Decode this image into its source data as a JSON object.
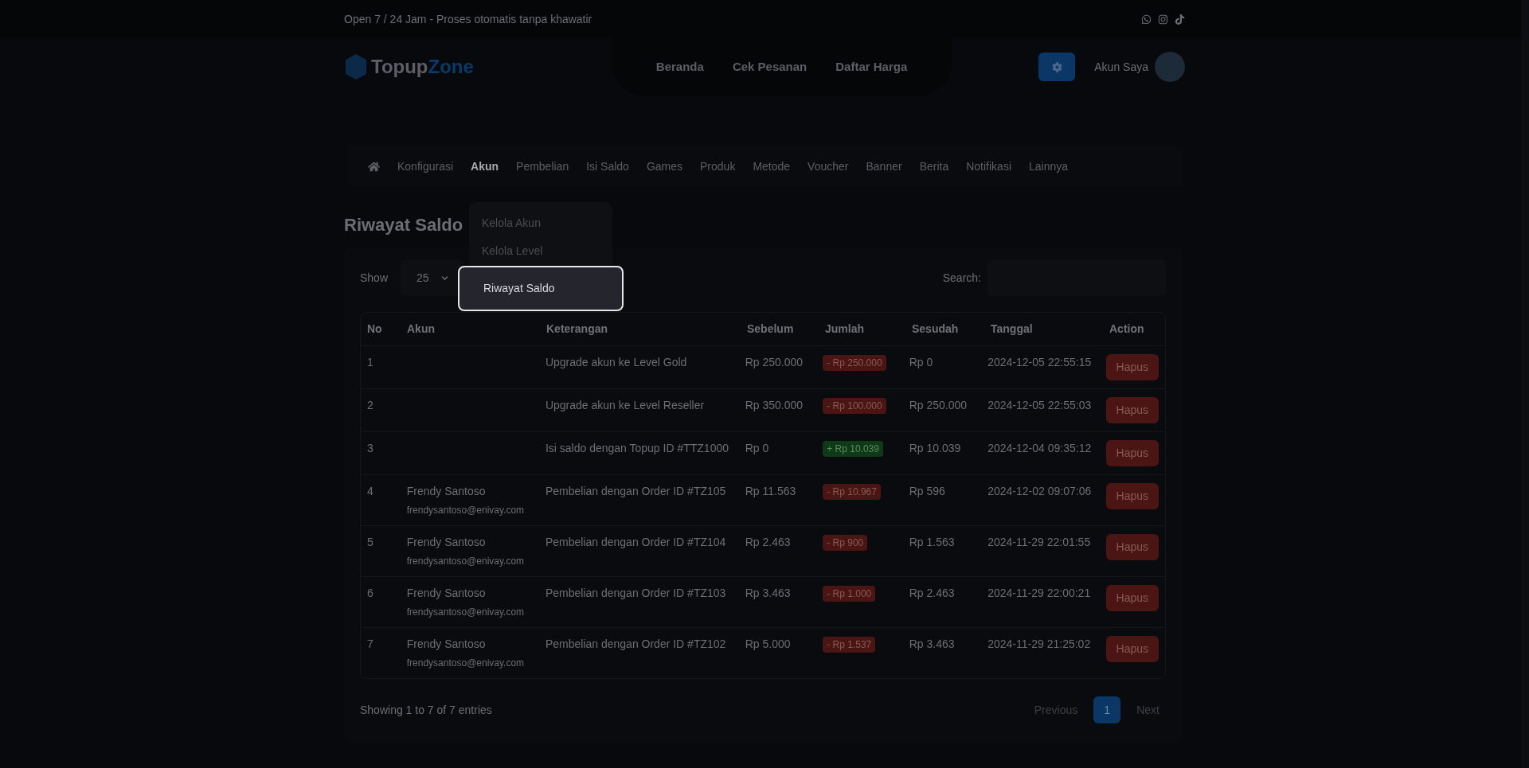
{
  "top_bar": {
    "text": "Open 7 / 24 Jam - Proses otomatis tanpa khawatir"
  },
  "header": {
    "logo": {
      "part_1": "Topup",
      "part_2": "Zone"
    },
    "nav": [
      "Beranda",
      "Cek Pesanan",
      "Daftar Harga"
    ],
    "account_label": "Akun Saya"
  },
  "admin_menu": [
    {
      "label": "Konfigurasi",
      "selected": false
    },
    {
      "label": "Akun",
      "selected": true
    },
    {
      "label": "Pembelian",
      "selected": false
    },
    {
      "label": "Isi Saldo",
      "selected": false
    },
    {
      "label": "Games",
      "selected": false
    },
    {
      "label": "Produk",
      "selected": false
    },
    {
      "label": "Metode",
      "selected": false
    },
    {
      "label": "Voucher",
      "selected": false
    },
    {
      "label": "Banner",
      "selected": false
    },
    {
      "label": "Berita",
      "selected": false
    },
    {
      "label": "Notifikasi",
      "selected": false
    },
    {
      "label": "Lainnya",
      "selected": false
    }
  ],
  "dropdown": [
    {
      "label": "Kelola Akun",
      "highlighted": false
    },
    {
      "label": "Kelola Level",
      "highlighted": false
    },
    {
      "label": "Riwayat Saldo",
      "highlighted": true
    }
  ],
  "page_title": "Riwayat Saldo",
  "controls": {
    "show_label": "Show",
    "page_size": "25",
    "search_label": "Search:"
  },
  "table": {
    "columns": [
      "No",
      "Akun",
      "Keterangan",
      "Sebelum",
      "Jumlah",
      "Sesudah",
      "Tanggal",
      "Action"
    ],
    "rows": [
      {
        "no": "1",
        "description": "Upgrade akun ke Level Gold",
        "before": "Rp 250.000",
        "amount": "- Rp 250.000",
        "kind": "debit",
        "after": "Rp 0",
        "date": "2024-12-05 22:55:15",
        "action": "Hapus"
      },
      {
        "no": "2",
        "description": "Upgrade akun ke Level Reseller",
        "before": "Rp 350.000",
        "amount": "- Rp 100.000",
        "kind": "debit",
        "after": "Rp 250.000",
        "date": "2024-12-05 22:55:03",
        "action": "Hapus"
      },
      {
        "no": "3",
        "description": "Isi saldo dengan Topup ID #TTZ1000",
        "before": "Rp 0",
        "amount": "+ Rp 10.039",
        "kind": "credit",
        "after": "Rp 10.039",
        "date": "2024-12-04 09:35:12",
        "action": "Hapus"
      },
      {
        "no": "4",
        "account_name": "Frendy Santoso",
        "account_email": "frendysantoso@enivay.com",
        "description": "Pembelian dengan Order ID #TZ105",
        "before": "Rp 11.563",
        "amount": "- Rp 10.967",
        "kind": "debit",
        "after": "Rp 596",
        "date": "2024-12-02 09:07:06",
        "action": "Hapus"
      },
      {
        "no": "5",
        "account_name": "Frendy Santoso",
        "account_email": "frendysantoso@enivay.com",
        "description": "Pembelian dengan Order ID #TZ104",
        "before": "Rp 2.463",
        "amount": "- Rp 900",
        "kind": "debit",
        "after": "Rp 1.563",
        "date": "2024-11-29 22:01:55",
        "action": "Hapus"
      },
      {
        "no": "6",
        "account_name": "Frendy Santoso",
        "account_email": "frendysantoso@enivay.com",
        "description": "Pembelian dengan Order ID #TZ103",
        "before": "Rp 3.463",
        "amount": "- Rp 1.000",
        "kind": "debit",
        "after": "Rp 2.463",
        "date": "2024-11-29 22:00:21",
        "action": "Hapus"
      },
      {
        "no": "7",
        "account_name": "Frendy Santoso",
        "account_email": "frendysantoso@enivay.com",
        "description": "Pembelian dengan Order ID #TZ102",
        "before": "Rp 5.000",
        "amount": "- Rp 1.537",
        "kind": "debit",
        "after": "Rp 3.463",
        "date": "2024-11-29 21:25:02",
        "action": "Hapus"
      }
    ]
  },
  "footer": {
    "info": "Showing 1 to 7 of 7 entries",
    "pagination": [
      {
        "label": "Previous",
        "selected": false
      },
      {
        "label": "1",
        "selected": true
      },
      {
        "label": "Next",
        "selected": false
      }
    ]
  }
}
